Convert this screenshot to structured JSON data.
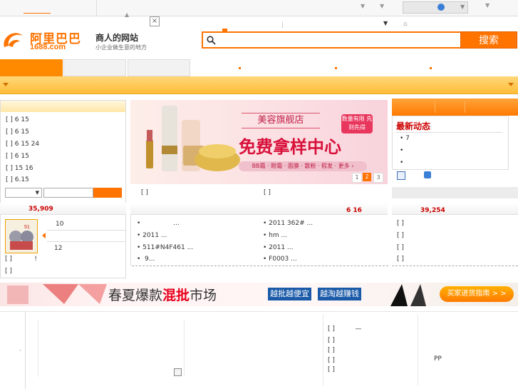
{
  "logo": {
    "cn": "阿里巴巴",
    "domain": "1688.com"
  },
  "slogan": {
    "main": "商人的网站",
    "sub": "小企业做生意的地方"
  },
  "search": {
    "button_label": "搜索"
  },
  "left_list": [
    "6 15",
    "6 15",
    "6 15  24",
    "6 15",
    "15        16",
    "6.15"
  ],
  "left_bullet": "[ ]",
  "banner": {
    "title": "美容旗舰店",
    "headline": "免费拿样中心",
    "badge": "数量有限 先到先得",
    "sub": "BB霜 · 眼霜 · 面膜 · 散粉 · 假发 · 更多 ›",
    "pages": [
      "1",
      "2",
      "3"
    ]
  },
  "right_panel": {
    "title": "最新动态",
    "items": [
      "7",
      "",
      ""
    ]
  },
  "stats": {
    "left": "35,909",
    "mid": "6 16",
    "right": "39,254"
  },
  "promo_item": {
    "line1": "10",
    "line2": "12",
    "line3": "!"
  },
  "middle_list": {
    "col1": [
      "...",
      "2011          ...",
      "511#N4F461          ...",
      "         9..."
    ],
    "col2": [
      "2011      362#      ...",
      "hm              ...",
      "2011                  ...",
      "F0003              ..."
    ]
  },
  "strip": {
    "title_a": "春夏爆款",
    "title_b": "混批",
    "title_c": "市场",
    "tag1": "越批越便宜",
    "tag2": "越淘越赚钱",
    "guide": "买家进货指南 > >"
  },
  "bottom": {
    "right_dash": "—",
    "pp": "PP"
  },
  "colors": {
    "brand": "#ff7300",
    "accent_red": "#cc0000"
  }
}
